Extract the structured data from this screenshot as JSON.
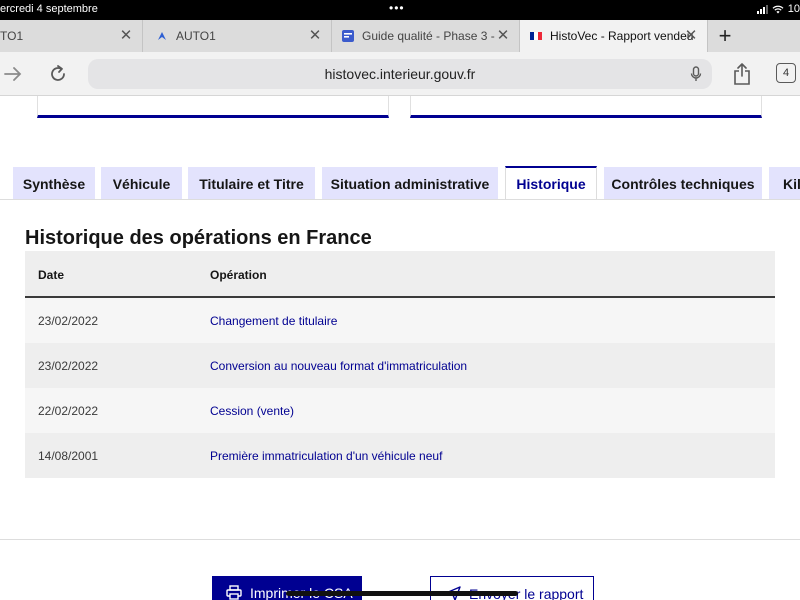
{
  "status_bar": {
    "date": "ercredi 4 septembre",
    "dots": "•••",
    "clock_partial": "10"
  },
  "browser_tabs": [
    {
      "title": "TO1",
      "icon": "generic-page-icon",
      "active": false
    },
    {
      "title": "AUTO1",
      "icon": "auto1-logo-icon",
      "active": false
    },
    {
      "title": "Guide qualité - Phase 3 -",
      "icon": "document-icon",
      "active": false
    },
    {
      "title": "HistoVec - Rapport vendeu",
      "icon": "french-flag-icon",
      "active": true
    }
  ],
  "new_tab_label": "+",
  "toolbar": {
    "url": "histovec.interieur.gouv.fr",
    "tab_count": "4"
  },
  "page_tabs": [
    {
      "label": "Synthèse",
      "active": false
    },
    {
      "label": "Véhicule",
      "active": false
    },
    {
      "label": "Titulaire et Titre",
      "active": false
    },
    {
      "label": "Situation administrative",
      "active": false
    },
    {
      "label": "Historique",
      "active": true
    },
    {
      "label": "Contrôles techniques",
      "active": false
    },
    {
      "label": "Kilo",
      "active": false
    }
  ],
  "history": {
    "title": "Historique des opérations en France",
    "columns": {
      "date": "Date",
      "operation": "Opération"
    },
    "rows": [
      {
        "date": "23/02/2022",
        "operation": "Changement de titulaire"
      },
      {
        "date": "23/02/2022",
        "operation": "Conversion au nouveau format d'immatriculation"
      },
      {
        "date": "22/02/2022",
        "operation": "Cession (vente)"
      },
      {
        "date": "14/08/2001",
        "operation": "Première immatriculation d'un véhicule neuf"
      }
    ]
  },
  "actions": {
    "print_label": "Imprimer le CSA",
    "send_label": "Envoyer le rapport"
  },
  "colors": {
    "primary": "#000091",
    "tab_inactive_bg": "#e3e3fd",
    "row_alt_bg": "#eeeeee"
  }
}
